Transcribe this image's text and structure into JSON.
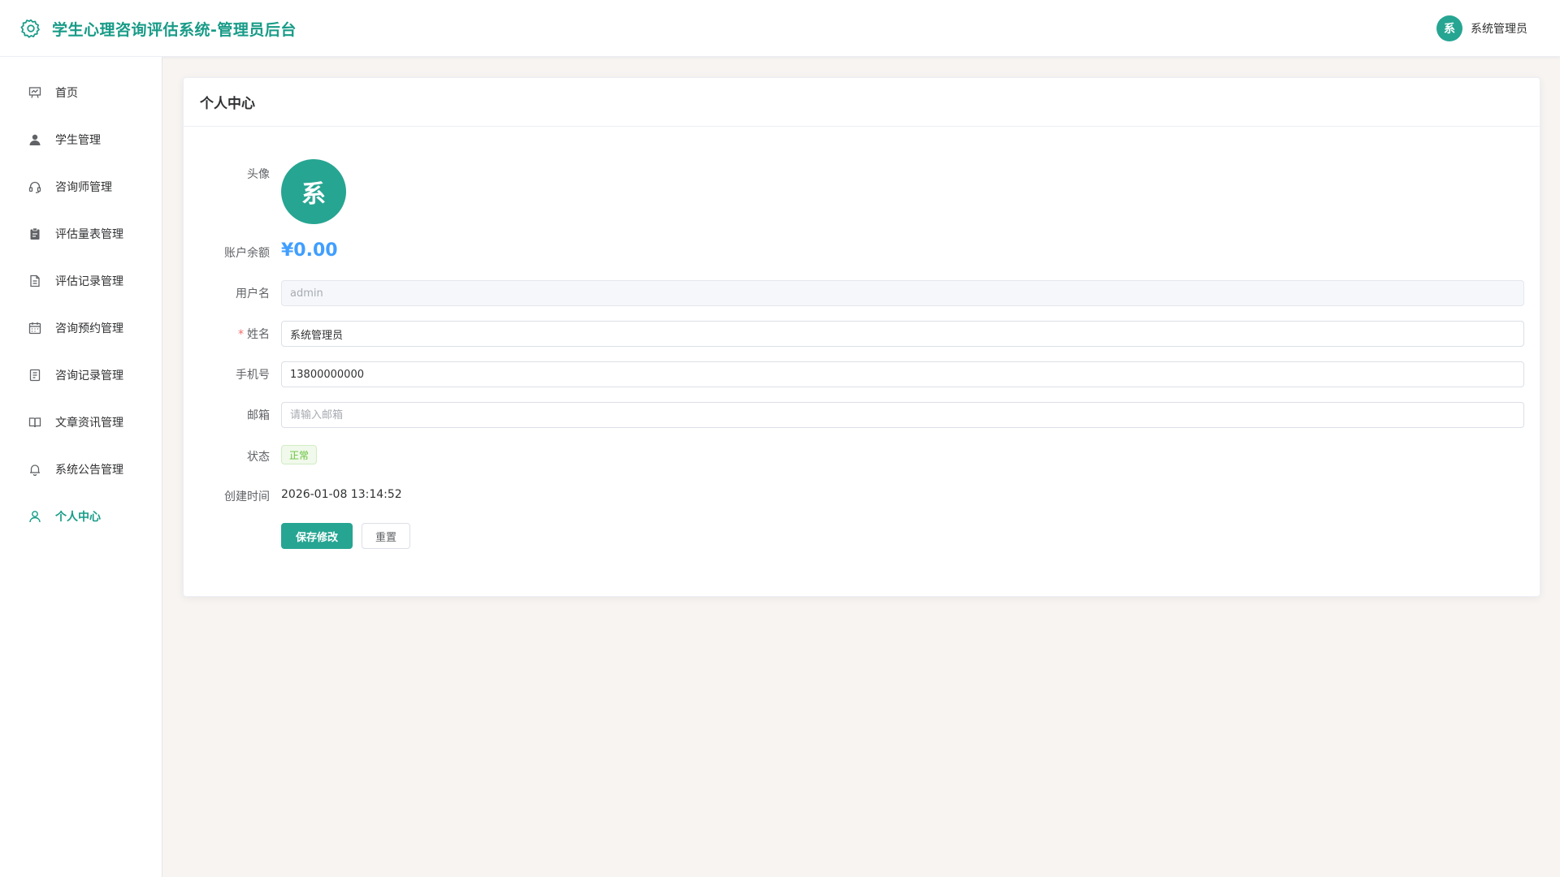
{
  "header": {
    "title": "学生心理咨询评估系统-管理员后台",
    "brand_icon": "gear-icon",
    "user_avatar_char": "系",
    "user_name": "系统管理员"
  },
  "sidebar": {
    "items": [
      {
        "label": "首页",
        "icon": "chart-board-icon"
      },
      {
        "label": "学生管理",
        "icon": "user-filled-icon"
      },
      {
        "label": "咨询师管理",
        "icon": "headset-icon"
      },
      {
        "label": "评估量表管理",
        "icon": "clipboard-icon"
      },
      {
        "label": "评估记录管理",
        "icon": "document-icon"
      },
      {
        "label": "咨询预约管理",
        "icon": "calendar-icon"
      },
      {
        "label": "咨询记录管理",
        "icon": "notebook-icon"
      },
      {
        "label": "文章资讯管理",
        "icon": "book-icon"
      },
      {
        "label": "系统公告管理",
        "icon": "bell-icon"
      },
      {
        "label": "个人中心",
        "icon": "user-icon",
        "active": true
      }
    ]
  },
  "card": {
    "title": "个人中心"
  },
  "form": {
    "avatar_label": "头像",
    "avatar_char": "系",
    "balance_label": "账户余额",
    "balance_value": "¥0.00",
    "username_label": "用户名",
    "username_value": "admin",
    "name_required_mark": "*",
    "name_label": "姓名",
    "name_value": "系统管理员",
    "phone_label": "手机号",
    "phone_value": "13800000000",
    "email_label": "邮箱",
    "email_value": "",
    "email_placeholder": "请输入邮箱",
    "status_label": "状态",
    "status_value": "正常",
    "created_label": "创建时间",
    "created_value": "2026-01-08 13:14:52"
  },
  "actions": {
    "save_label": "保存修改",
    "reset_label": "重置"
  },
  "colors": {
    "brand": "#179b87",
    "primary": "#26a592",
    "balance": "#409eff",
    "success": "#67c23a"
  }
}
